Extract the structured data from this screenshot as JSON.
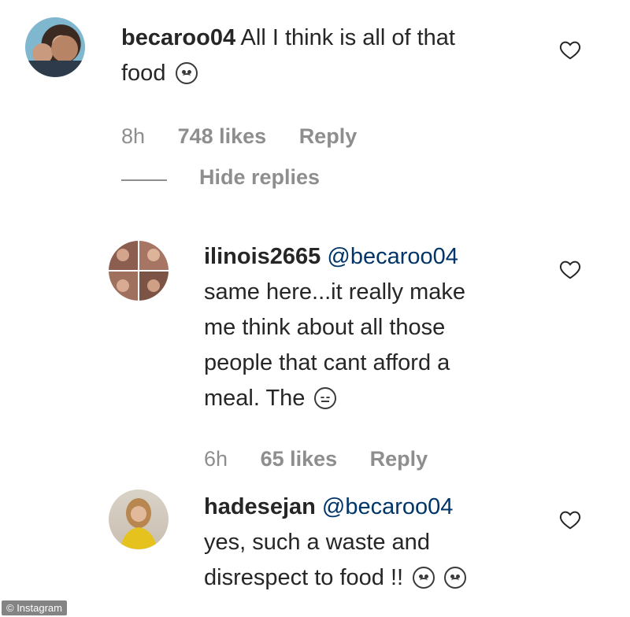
{
  "comments": [
    {
      "username": "becaroo04",
      "text_line1": "All I think is all of that",
      "text_line2": "food",
      "time": "8h",
      "likes": "748 likes",
      "reply": "Reply"
    },
    {
      "username": "ilinois2665",
      "mention": "@becaroo04",
      "lines": [
        "same here...it really make",
        "me think about all those",
        "people that cant afford a",
        "meal. The"
      ],
      "time": "6h",
      "likes": "65 likes",
      "reply": "Reply"
    },
    {
      "username": "hadesejan",
      "mention": "@becaroo04",
      "lines": [
        "yes, such a waste and",
        "disrespect to food !!"
      ]
    }
  ],
  "hide_replies": "Hide replies",
  "watermark": "© Instagram"
}
